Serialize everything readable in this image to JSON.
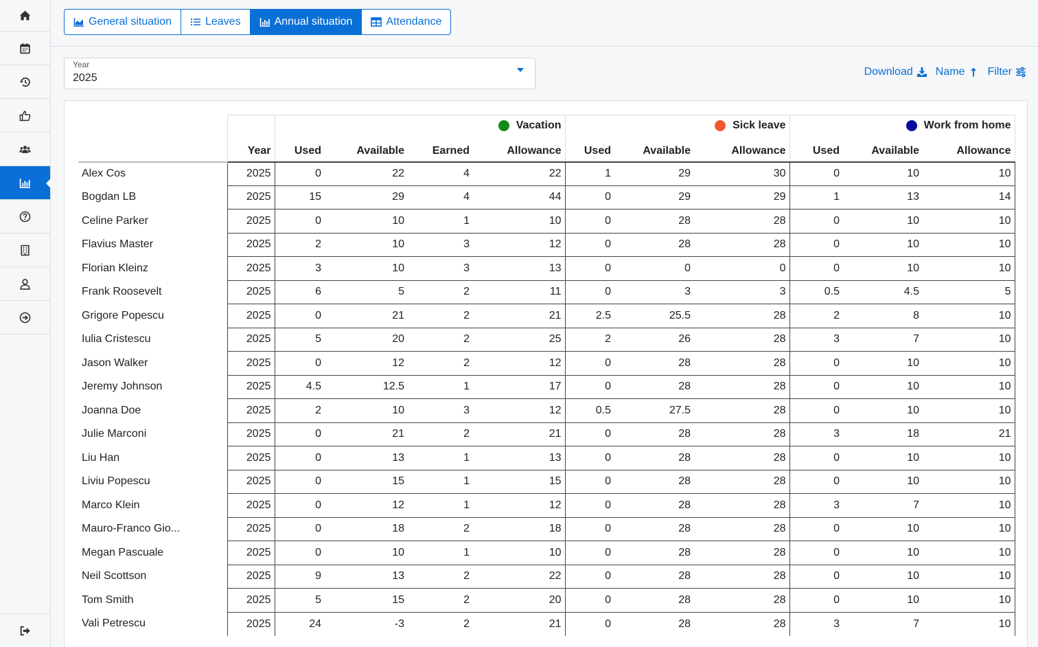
{
  "sidebar": {
    "items": [
      {
        "icon": "home-icon"
      },
      {
        "icon": "calendar-icon"
      },
      {
        "icon": "history-icon"
      },
      {
        "icon": "thumbs-up-icon"
      },
      {
        "icon": "users-icon"
      },
      {
        "icon": "bar-chart-icon",
        "active": true
      },
      {
        "icon": "help-icon"
      },
      {
        "icon": "building-icon"
      },
      {
        "icon": "user-icon"
      },
      {
        "icon": "arrow-circle-right-icon"
      }
    ],
    "logout_icon": "sign-out-icon"
  },
  "tabs": [
    {
      "label": "General situation",
      "icon": "area-chart-icon"
    },
    {
      "label": "Leaves",
      "icon": "list-icon"
    },
    {
      "label": "Annual situation",
      "icon": "bar-chart-icon",
      "active": true
    },
    {
      "label": "Attendance",
      "icon": "table-icon"
    }
  ],
  "year_select": {
    "label": "Year",
    "value": "2025"
  },
  "actions": {
    "download": "Download",
    "name": "Name",
    "filter": "Filter"
  },
  "colors": {
    "accent": "#0a6fd6",
    "vacation": "#138a17",
    "sick_leave": "#f0582f",
    "work_from_home": "#0a0a9e"
  },
  "table": {
    "groups": {
      "vacation": "Vacation",
      "sick_leave": "Sick leave",
      "work_from_home": "Work from home"
    },
    "headers": {
      "year": "Year",
      "vacation": [
        "Used",
        "Available",
        "Earned",
        "Allowance"
      ],
      "sick_leave": [
        "Used",
        "Available",
        "Allowance"
      ],
      "work_from_home": [
        "Used",
        "Available",
        "Allowance"
      ]
    },
    "rows": [
      {
        "name": "Alex Cos",
        "year": "2025",
        "v": [
          "0",
          "22",
          "4",
          "22"
        ],
        "s": [
          "1",
          "29",
          "30"
        ],
        "w": [
          "0",
          "10",
          "10"
        ]
      },
      {
        "name": "Bogdan LB",
        "year": "2025",
        "v": [
          "15",
          "29",
          "4",
          "44"
        ],
        "s": [
          "0",
          "29",
          "29"
        ],
        "w": [
          "1",
          "13",
          "14"
        ]
      },
      {
        "name": "Celine Parker",
        "year": "2025",
        "v": [
          "0",
          "10",
          "1",
          "10"
        ],
        "s": [
          "0",
          "28",
          "28"
        ],
        "w": [
          "0",
          "10",
          "10"
        ]
      },
      {
        "name": "Flavius Master",
        "year": "2025",
        "v": [
          "2",
          "10",
          "3",
          "12"
        ],
        "s": [
          "0",
          "28",
          "28"
        ],
        "w": [
          "0",
          "10",
          "10"
        ]
      },
      {
        "name": "Florian Kleinz",
        "year": "2025",
        "v": [
          "3",
          "10",
          "3",
          "13"
        ],
        "s": [
          "0",
          "0",
          "0"
        ],
        "w": [
          "0",
          "10",
          "10"
        ]
      },
      {
        "name": "Frank Roosevelt",
        "year": "2025",
        "v": [
          "6",
          "5",
          "2",
          "11"
        ],
        "s": [
          "0",
          "3",
          "3"
        ],
        "w": [
          "0.5",
          "4.5",
          "5"
        ]
      },
      {
        "name": "Grigore Popescu",
        "year": "2025",
        "v": [
          "0",
          "21",
          "2",
          "21"
        ],
        "s": [
          "2.5",
          "25.5",
          "28"
        ],
        "w": [
          "2",
          "8",
          "10"
        ]
      },
      {
        "name": "Iulia Cristescu",
        "year": "2025",
        "v": [
          "5",
          "20",
          "2",
          "25"
        ],
        "s": [
          "2",
          "26",
          "28"
        ],
        "w": [
          "3",
          "7",
          "10"
        ]
      },
      {
        "name": "Jason Walker",
        "year": "2025",
        "v": [
          "0",
          "12",
          "2",
          "12"
        ],
        "s": [
          "0",
          "28",
          "28"
        ],
        "w": [
          "0",
          "10",
          "10"
        ]
      },
      {
        "name": "Jeremy Johnson",
        "year": "2025",
        "v": [
          "4.5",
          "12.5",
          "1",
          "17"
        ],
        "s": [
          "0",
          "28",
          "28"
        ],
        "w": [
          "0",
          "10",
          "10"
        ]
      },
      {
        "name": "Joanna Doe",
        "year": "2025",
        "v": [
          "2",
          "10",
          "3",
          "12"
        ],
        "s": [
          "0.5",
          "27.5",
          "28"
        ],
        "w": [
          "0",
          "10",
          "10"
        ]
      },
      {
        "name": "Julie Marconi",
        "year": "2025",
        "v": [
          "0",
          "21",
          "2",
          "21"
        ],
        "s": [
          "0",
          "28",
          "28"
        ],
        "w": [
          "3",
          "18",
          "21"
        ]
      },
      {
        "name": "Liu Han",
        "year": "2025",
        "v": [
          "0",
          "13",
          "1",
          "13"
        ],
        "s": [
          "0",
          "28",
          "28"
        ],
        "w": [
          "0",
          "10",
          "10"
        ]
      },
      {
        "name": "Liviu Popescu",
        "year": "2025",
        "v": [
          "0",
          "15",
          "1",
          "15"
        ],
        "s": [
          "0",
          "28",
          "28"
        ],
        "w": [
          "0",
          "10",
          "10"
        ]
      },
      {
        "name": "Marco Klein",
        "year": "2025",
        "v": [
          "0",
          "12",
          "1",
          "12"
        ],
        "s": [
          "0",
          "28",
          "28"
        ],
        "w": [
          "3",
          "7",
          "10"
        ]
      },
      {
        "name": "Mauro-Franco Gio...",
        "year": "2025",
        "v": [
          "0",
          "18",
          "2",
          "18"
        ],
        "s": [
          "0",
          "28",
          "28"
        ],
        "w": [
          "0",
          "10",
          "10"
        ]
      },
      {
        "name": "Megan Pascuale",
        "year": "2025",
        "v": [
          "0",
          "10",
          "1",
          "10"
        ],
        "s": [
          "0",
          "28",
          "28"
        ],
        "w": [
          "0",
          "10",
          "10"
        ]
      },
      {
        "name": "Neil Scottson",
        "year": "2025",
        "v": [
          "9",
          "13",
          "2",
          "22"
        ],
        "s": [
          "0",
          "28",
          "28"
        ],
        "w": [
          "0",
          "10",
          "10"
        ]
      },
      {
        "name": "Tom Smith",
        "year": "2025",
        "v": [
          "5",
          "15",
          "2",
          "20"
        ],
        "s": [
          "0",
          "28",
          "28"
        ],
        "w": [
          "0",
          "10",
          "10"
        ]
      },
      {
        "name": "Vali Petrescu",
        "year": "2025",
        "v": [
          "24",
          "-3",
          "2",
          "21"
        ],
        "s": [
          "0",
          "28",
          "28"
        ],
        "w": [
          "3",
          "7",
          "10"
        ]
      }
    ]
  }
}
